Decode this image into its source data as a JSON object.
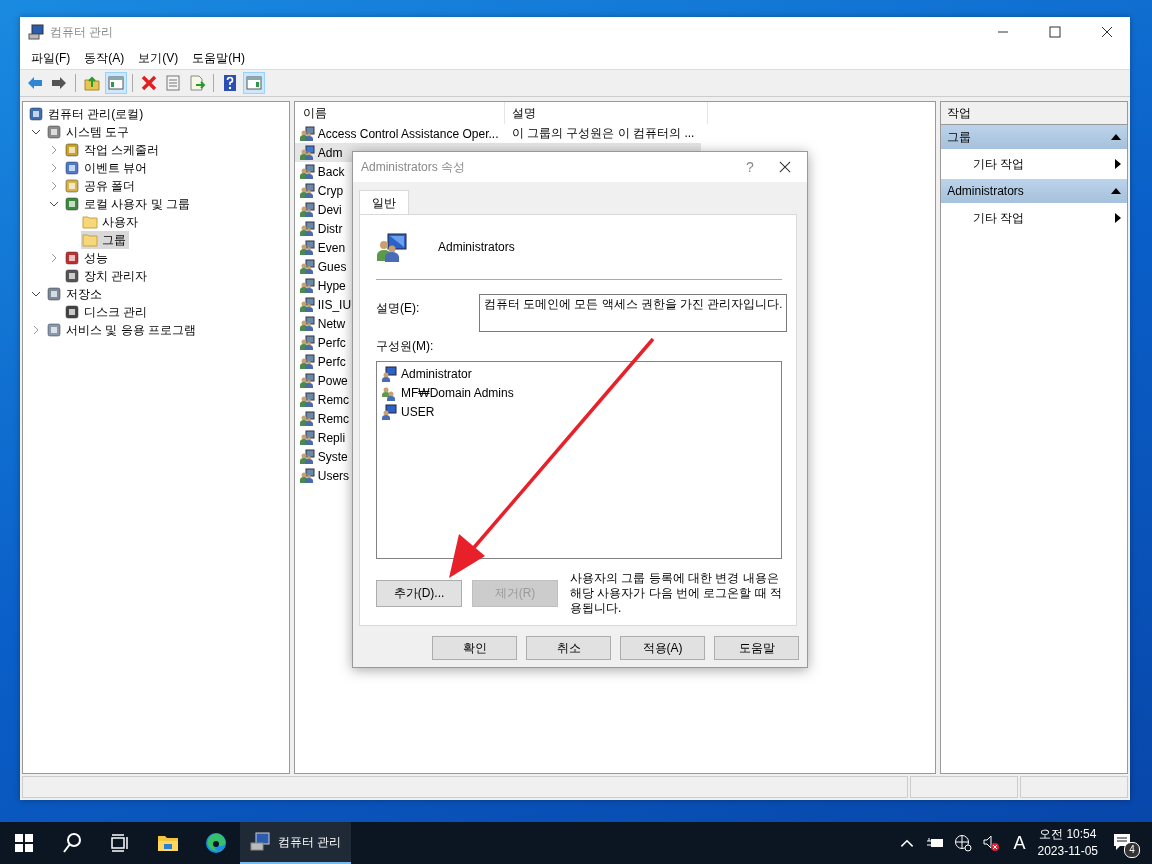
{
  "window": {
    "title": "컴퓨터 관리"
  },
  "menu": [
    "파일(F)",
    "동작(A)",
    "보기(V)",
    "도움말(H)"
  ],
  "toolbar": [
    {
      "kind": "back",
      "pressed": false
    },
    {
      "kind": "forward",
      "pressed": false
    },
    {
      "kind": "separator"
    },
    {
      "kind": "up",
      "pressed": false
    },
    {
      "kind": "tree",
      "pressed": true
    },
    {
      "kind": "separator"
    },
    {
      "kind": "delete",
      "pressed": false
    },
    {
      "kind": "properties",
      "pressed": false
    },
    {
      "kind": "export",
      "pressed": false
    },
    {
      "kind": "separator"
    },
    {
      "kind": "help",
      "pressed": false
    },
    {
      "kind": "pane",
      "pressed": true
    }
  ],
  "tree": [
    {
      "label": "컴퓨터 관리(로컬)",
      "kind": "computer",
      "selected": false,
      "children": [
        {
          "label": "시스템 도구",
          "kind": "tool",
          "selected": false,
          "expanded": true,
          "children": [
            {
              "label": "작업 스케줄러",
              "kind": "clock",
              "selected": false,
              "expanded": false
            },
            {
              "label": "이벤트 뷰어",
              "kind": "event",
              "selected": false,
              "expanded": false
            },
            {
              "label": "공유 폴더",
              "kind": "share",
              "selected": false,
              "expanded": false
            },
            {
              "label": "로컬 사용자 및 그룹",
              "kind": "users",
              "selected": false,
              "expanded": true,
              "children": [
                {
                  "label": "사용자",
                  "kind": "folder",
                  "selected": false
                },
                {
                  "label": "그룹",
                  "kind": "folder",
                  "selected": true
                }
              ]
            },
            {
              "label": "성능",
              "kind": "perf",
              "selected": false,
              "expanded": false
            },
            {
              "label": "장치 관리자",
              "kind": "device",
              "selected": false
            }
          ]
        },
        {
          "label": "저장소",
          "kind": "storage",
          "selected": false,
          "expanded": true,
          "children": [
            {
              "label": "디스크 관리",
              "kind": "disk",
              "selected": false
            }
          ]
        },
        {
          "label": "서비스 및 응용 프로그램",
          "kind": "services",
          "selected": false,
          "expanded": false
        }
      ]
    }
  ],
  "list": {
    "columns": [
      "이름",
      "설명"
    ],
    "rows": [
      {
        "name": "Access Control Assistance Oper...",
        "description": "이 그룹의 구성원은 이 컴퓨터의 ...",
        "selected": false
      },
      {
        "name": "Adm",
        "selected": true
      },
      {
        "name": "Back",
        "selected": false
      },
      {
        "name": "Cryp",
        "selected": false
      },
      {
        "name": "Devi",
        "selected": false
      },
      {
        "name": "Distr",
        "selected": false
      },
      {
        "name": "Even",
        "selected": false
      },
      {
        "name": "Gues",
        "selected": false
      },
      {
        "name": "Hype",
        "selected": false
      },
      {
        "name": "IIS_IU",
        "selected": false
      },
      {
        "name": "Netw",
        "selected": false
      },
      {
        "name": "Perfc",
        "selected": false
      },
      {
        "name": "Perfc",
        "selected": false
      },
      {
        "name": "Powe",
        "selected": false
      },
      {
        "name": "Remc",
        "selected": false
      },
      {
        "name": "Remc",
        "selected": false
      },
      {
        "name": "Repli",
        "selected": false
      },
      {
        "name": "Syste",
        "selected": false
      },
      {
        "name": "Users",
        "selected": false
      }
    ]
  },
  "actions": {
    "header": "작업",
    "sections": [
      {
        "title": "그룹",
        "items": [
          "기타 작업"
        ]
      },
      {
        "title": "Administrators",
        "items": [
          "기타 작업"
        ]
      }
    ]
  },
  "dialog": {
    "title": "Administrators 속성",
    "help_button": "?",
    "tabs": [
      {
        "label": "일반",
        "selected": true
      }
    ],
    "group_name": "Administrators",
    "description_label": "설명(E):",
    "description": "컴퓨터 도메인에 모든 액세스 권한을 가진 관리자입니다.",
    "members_label": "구성원(M):",
    "members": [
      {
        "name": "Administrator",
        "kind": "user"
      },
      {
        "name": "MF₩Domain Admins",
        "kind": "group"
      },
      {
        "name": "USER",
        "kind": "user"
      }
    ],
    "member_buttons": [
      {
        "label": "추가(D)...",
        "disabled": false
      },
      {
        "label": "제거(R)",
        "disabled": true
      }
    ],
    "note": "사용자의 그룹 등록에 대한 변경 내용은 해당 사용자가 다음 번에 로그온할 때 적용됩니다.",
    "buttons": [
      "확인",
      "취소",
      "적용(A)",
      "도움말"
    ]
  },
  "taskbar": {
    "pinned": [
      {
        "kind": "start"
      },
      {
        "kind": "search"
      },
      {
        "kind": "taskview"
      },
      {
        "kind": "explorer"
      },
      {
        "kind": "edge"
      }
    ],
    "running": [
      {
        "label": "컴퓨터 관리",
        "active": true
      }
    ],
    "ime": "A",
    "time": "오전 10:54",
    "date": "2023-11-05",
    "notifications": "4"
  }
}
